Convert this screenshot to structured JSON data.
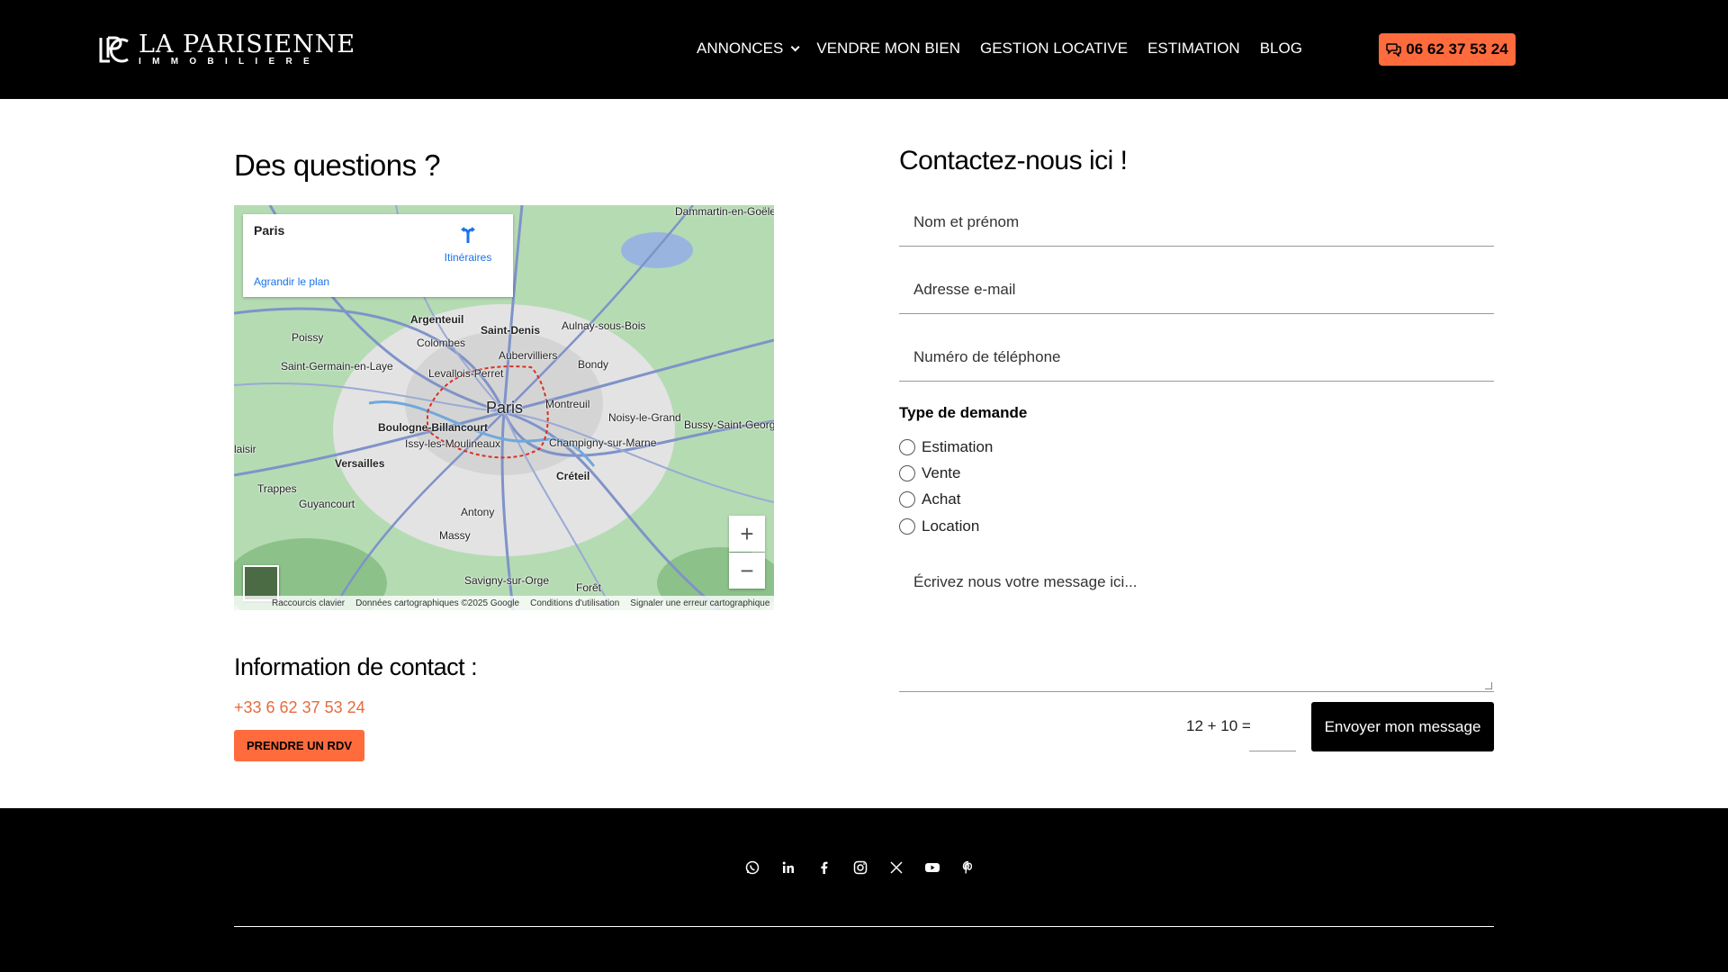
{
  "header": {
    "logo_title": "LA PARISIENNE",
    "logo_subtitle": "IMMOBILIERE",
    "nav": [
      {
        "label": "ANNONCES"
      },
      {
        "label": "VENDRE MON BIEN"
      },
      {
        "label": "GESTION LOCATIVE"
      },
      {
        "label": "ESTIMATION"
      },
      {
        "label": "BLOG"
      }
    ],
    "phone": "06 62 37 53 24"
  },
  "left": {
    "heading": "Des questions ?",
    "map": {
      "place": "Paris",
      "directions": "Itinéraires",
      "enlarge": "Agrandir le plan",
      "zoom_in": "+",
      "zoom_out": "−",
      "footer": {
        "shortcuts": "Raccourcis clavier",
        "data": "Données cartographiques ©2025 Google",
        "terms": "Conditions d'utilisation",
        "report": "Signaler une erreur cartographique"
      },
      "labels": {
        "paris": "Paris",
        "argenteuil": "Argenteuil",
        "saint_denis": "Saint-Denis",
        "aulnay": "Aulnay-sous-Bois",
        "poissy": "Poissy",
        "colombes": "Colombes",
        "aubervilliers": "Aubervilliers",
        "bondy": "Bondy",
        "sgl": "Saint-Germain-en-Laye",
        "levallois": "Levallois-Perret",
        "montreuil": "Montreuil",
        "noisy": "Noisy-le-Grand",
        "bussy": "Bussy-Saint-Georg",
        "boulogne": "Boulogne-Billancourt",
        "issy": "Issy-les-Moulineaux",
        "champigny": "Champigny-sur-Marne",
        "versailles": "Versailles",
        "creteil": "Créteil",
        "trappes": "Trappes",
        "guyancourt": "Guyancourt",
        "antony": "Antony",
        "massy": "Massy",
        "savigny": "Savigny-sur-Orge",
        "dammartin": "Dammartin-en-Goële",
        "foret": "Forêt",
        "plaisir": "laisir"
      }
    },
    "contact_heading": "Information de contact :",
    "contact_phone": "+33 6 62 37 53 24",
    "rdv_button": "PRENDRE UN RDV"
  },
  "right": {
    "heading": "Contactez-nous ici !",
    "fields": {
      "name": "Nom et prénom",
      "email": "Adresse e-mail",
      "phone": "Numéro de téléphone"
    },
    "type_label": "Type de demande",
    "options": [
      "Estimation",
      "Vente",
      "Achat",
      "Location"
    ],
    "message_placeholder": "Écrivez nous votre message ici...",
    "captcha": "12 + 10 =",
    "submit": "Envoyer mon message"
  },
  "colors": {
    "accent": "#ff6b3d",
    "link": "#e56b3d",
    "dark": "#000000"
  },
  "footer": {
    "socials": [
      "whatsapp-icon",
      "linkedin-icon",
      "facebook-icon",
      "instagram-icon",
      "x-icon",
      "youtube-icon",
      "pinterest-icon"
    ]
  }
}
